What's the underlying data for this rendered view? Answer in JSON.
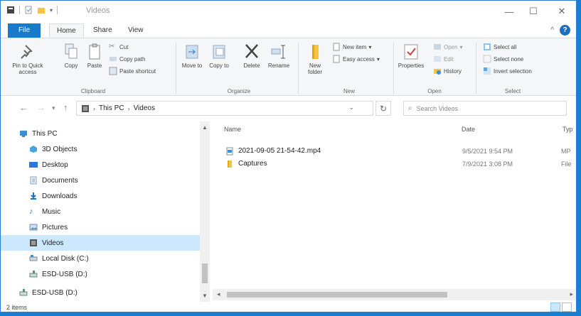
{
  "window": {
    "title": "Videos",
    "controls": {
      "minimize": "—",
      "maximize": "☐",
      "close": "✕"
    }
  },
  "ribbon_tabs": {
    "file": "File",
    "home": "Home",
    "share": "Share",
    "view": "View",
    "collapse": "^",
    "help": "?"
  },
  "ribbon": {
    "clipboard": {
      "group_label": "Clipboard",
      "pin_to_quick_access": "Pin to Quick access",
      "copy": "Copy",
      "paste": "Paste",
      "cut": "Cut",
      "copy_path": "Copy path",
      "paste_shortcut": "Paste shortcut"
    },
    "organize": {
      "group_label": "Organize",
      "move_to": "Move to",
      "copy_to": "Copy to",
      "delete": "Delete",
      "rename": "Rename"
    },
    "new": {
      "group_label": "New",
      "new_folder": "New folder",
      "new_item": "New item",
      "easy_access": "Easy access"
    },
    "open": {
      "group_label": "Open",
      "properties": "Properties",
      "open": "Open",
      "edit": "Edit",
      "history": "History"
    },
    "select": {
      "group_label": "Select",
      "select_all": "Select all",
      "select_none": "Select none",
      "invert_selection": "Invert selection"
    }
  },
  "address": {
    "crumbs": [
      "This PC",
      "Videos"
    ],
    "separator": "›"
  },
  "search": {
    "placeholder": "Search Videos"
  },
  "nav": {
    "items": [
      {
        "label": "This PC",
        "icon": "pc-icon",
        "color": "#3b8fd8"
      },
      {
        "label": "3D Objects",
        "icon": "cube-icon",
        "color": "#49a3e0"
      },
      {
        "label": "Desktop",
        "icon": "desktop-icon",
        "color": "#2a78d0"
      },
      {
        "label": "Documents",
        "icon": "documents-icon",
        "color": "#8aa0b8"
      },
      {
        "label": "Downloads",
        "icon": "download-icon",
        "color": "#1f72c9"
      },
      {
        "label": "Music",
        "icon": "music-icon",
        "color": "#2b79c8"
      },
      {
        "label": "Pictures",
        "icon": "pictures-icon",
        "color": "#6a8fb5"
      },
      {
        "label": "Videos",
        "icon": "videos-icon",
        "color": "#555"
      },
      {
        "label": "Local Disk (C:)",
        "icon": "disk-icon",
        "color": "#7a8a99"
      },
      {
        "label": "ESD-USB (D:)",
        "icon": "usb-drive-icon",
        "color": "#5c8f6e"
      },
      {
        "label": "ESD-USB (D:)",
        "icon": "usb-drive-icon",
        "color": "#5c8f6e"
      }
    ]
  },
  "files": {
    "columns": {
      "name": "Name",
      "date": "Date",
      "type": "Typ"
    },
    "rows": [
      {
        "name": "2021-09-05 21-54-42.mp4",
        "date": "9/5/2021 9:54 PM",
        "type": "MP",
        "icon": "video-file-icon"
      },
      {
        "name": "Captures",
        "date": "7/9/2021 3:08 PM",
        "type": "File",
        "icon": "folder-icon"
      }
    ]
  },
  "status": {
    "item_count": "2 items"
  },
  "colors": {
    "accent": "#1979ca",
    "selected": "#cce8ff",
    "folder": "#f5c542"
  }
}
